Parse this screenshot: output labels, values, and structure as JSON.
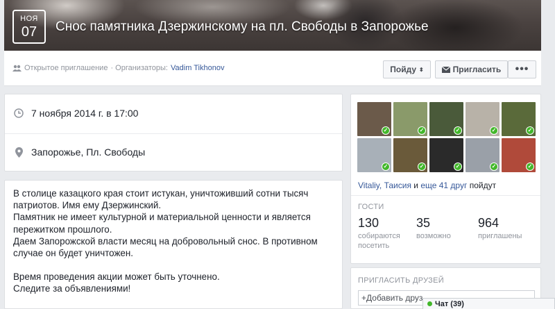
{
  "header": {
    "month": "НОЯ",
    "day": "07",
    "title": "Снос памятника Дзержинскому на пл. Свободы в Запорожье"
  },
  "subbar": {
    "privacy": "Открытое приглашение",
    "organizers_prefix": "· Организаторы:",
    "organizer": "Vadim Tikhonov",
    "going_button": "Пойду",
    "invite_button": "Пригласить",
    "more_button": "•••"
  },
  "details": {
    "date": "7 ноября 2014 г. в 17:00",
    "location": "Запорожье, Пл. Свободы"
  },
  "description": {
    "p1": "В столице казацкого края стоит истукан, уничтоживший сотни тысяч патриотов. Имя ему Дзержинский.\nПамятник не имеет культурной и материальной ценности и является пережитком прошлого.\nДаем Запорожской власти месяц на добровольный снос. В противном случае он будет уничтожен.",
    "p2": "Время проведения акции может быть уточнено.\nСледите за объявлениями!"
  },
  "guests": {
    "going_names": "Vitaliy, Таисия",
    "going_and": " и ",
    "going_more": "еще 41 друг",
    "going_suffix": " пойдут",
    "label": "ГОСТИ",
    "stats": [
      {
        "num": "130",
        "label": "собираются\nпосетить"
      },
      {
        "num": "35",
        "label": "возможно"
      },
      {
        "num": "964",
        "label": "приглашены"
      }
    ],
    "photos": [
      {
        "color": "#6b5a4a"
      },
      {
        "color": "#8a9a6a"
      },
      {
        "color": "#4a5a3a"
      },
      {
        "color": "#b8b2a8"
      },
      {
        "color": "#5a6a3a"
      },
      {
        "color": "#a8b0b8"
      },
      {
        "color": "#6a5a3a"
      },
      {
        "color": "#2a2a2a"
      },
      {
        "color": "#9aa0a8"
      },
      {
        "color": "#b04a3a"
      }
    ]
  },
  "invite": {
    "label": "ПРИГЛАСИТЬ ДРУЗЕЙ",
    "input_text": "+Добавить друз"
  },
  "chat": {
    "label": "Чат (39)"
  },
  "colors": {
    "link": "#365899",
    "online": "#42b72a"
  }
}
